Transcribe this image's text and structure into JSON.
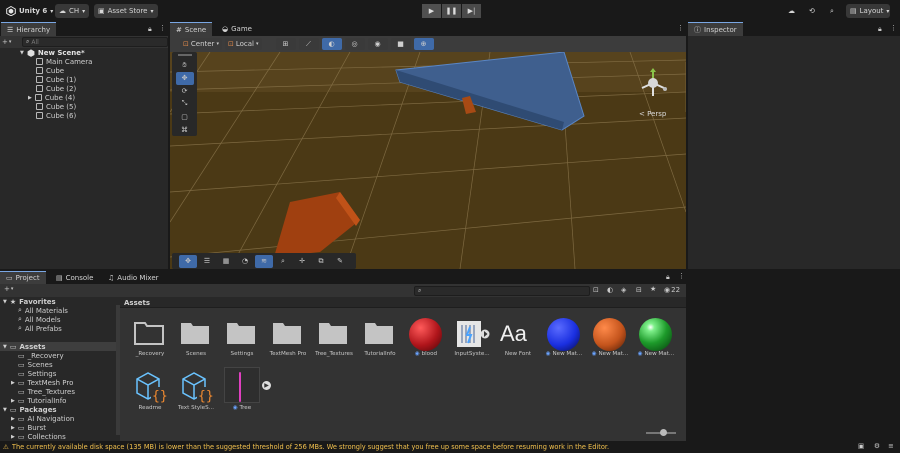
{
  "toolbar": {
    "logo": "Unity 6",
    "account": "CH",
    "asset_store": "Asset Store",
    "layout": "Layout",
    "icons": [
      "unity-logo-icon",
      "cloud-icon",
      "history-icon",
      "search-icon",
      "play-icon",
      "pause-icon",
      "step-icon"
    ]
  },
  "hierarchy": {
    "tab": "Hierarchy",
    "search_placeholder": "All",
    "scene": "New Scene*",
    "items": [
      "Main Camera",
      "Cube",
      "Cube (1)",
      "Cube (2)",
      "Cube (4)",
      "Cube (5)",
      "Cube (6)"
    ]
  },
  "scene_tabs": {
    "scene": "Scene",
    "game": "Game"
  },
  "scene_toolbar": {
    "pivot": "Center",
    "space": "Local"
  },
  "scene_view": {
    "persp": "< Persp"
  },
  "inspector": {
    "tab": "Inspector"
  },
  "bottom_tabs": {
    "project": "Project",
    "console": "Console",
    "audio": "Audio Mixer"
  },
  "project": {
    "count": "22",
    "favorites_title": "Favorites",
    "favorites": [
      "All Materials",
      "All Models",
      "All Prefabs"
    ],
    "assets_title": "Assets",
    "folders": [
      "_Recovery",
      "Scenes",
      "Settings",
      "TextMesh Pro",
      "Tree_Textures",
      "TutorialInfo"
    ],
    "packages_title": "Packages",
    "packages": [
      "AI Navigation",
      "Burst",
      "Collections"
    ],
    "breadcrumb": "Assets",
    "grid": [
      "_Recovery",
      "Scenes",
      "Settings",
      "TextMesh Pro",
      "Tree_Textures",
      "TutorialInfo",
      "blood",
      "InputSyste...",
      "New Font",
      "New Mat...",
      "New Mat...",
      "New Mat...",
      "Readme",
      "Text StyleS...",
      "Tree"
    ],
    "font_glyph": "Aa",
    "colors": {
      "blood": "#c0151b",
      "mat_blue": "#1a2fe0",
      "mat_orange": "#c4541c",
      "mat_green": "#1d9a2a"
    }
  },
  "status": {
    "message": "The currently available disk space (135 MB) is lower than the suggested threshold of 256 MBs. We strongly suggest that you free up some space before resuming work in the Editor."
  }
}
